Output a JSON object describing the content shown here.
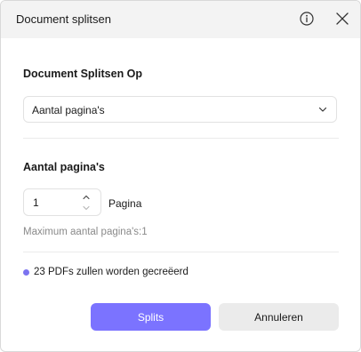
{
  "header": {
    "title": "Document splitsen",
    "info_icon": "info-icon",
    "close_icon": "close-icon"
  },
  "split": {
    "section_label": "Document Splitsen Op",
    "selected_option": "Aantal pagina's",
    "chevron_icon": "chevron-down-icon"
  },
  "pages": {
    "section_label": "Aantal pagina's",
    "value": "1",
    "unit_label": "Pagina",
    "max_text": "Maximum aantal pagina's:1"
  },
  "status": {
    "text": "23 PDFs zullen worden gecreëerd",
    "dot_color": "#7b73f0"
  },
  "buttons": {
    "primary_label": "Splits",
    "secondary_label": "Annuleren",
    "primary_color": "#7b73ff"
  }
}
